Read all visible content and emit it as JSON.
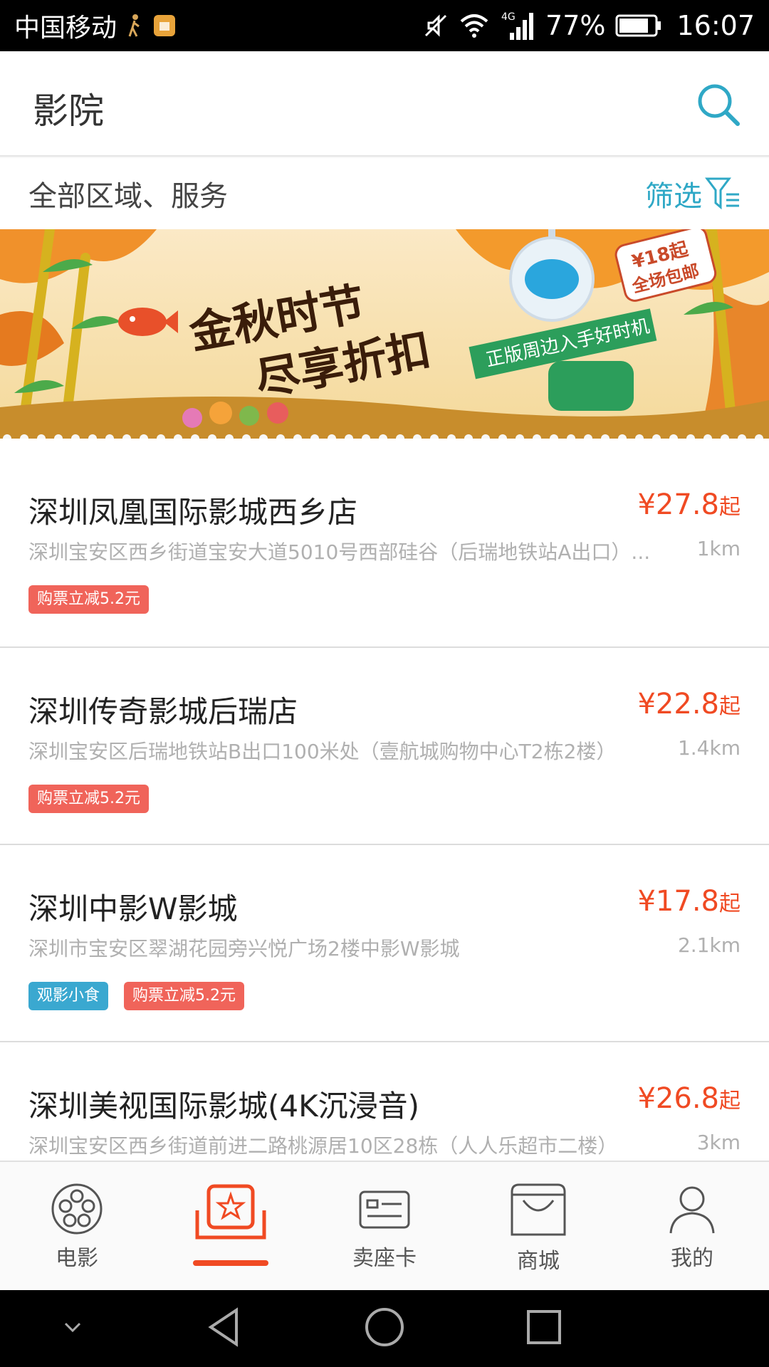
{
  "status_bar": {
    "carrier": "中国移动",
    "network": "4G",
    "battery": "77%",
    "time": "16:07"
  },
  "header": {
    "title": "影院",
    "search_icon": "search-icon"
  },
  "filter_bar": {
    "region": "全部区域、服务",
    "filter_label": "筛选"
  },
  "banner": {
    "headline_line1": "金秋时节",
    "headline_line2": "尽享折扣",
    "ribbon": "正版周边入手好时机",
    "badge_line1": "¥18起",
    "badge_line2": "全场包邮"
  },
  "cinemas": [
    {
      "name": "深圳凤凰国际影城西乡店",
      "price": "¥27.8",
      "price_suffix": "起",
      "address": "深圳宝安区西乡街道宝安大道5010号西部硅谷（后瑞地铁站A出口）...",
      "distance": "1km",
      "tags": [
        "购票立减5.2元"
      ]
    },
    {
      "name": "深圳传奇影城后瑞店",
      "price": "¥22.8",
      "price_suffix": "起",
      "address": "深圳宝安区后瑞地铁站B出口100米处（壹航城购物中心T2栋2楼）",
      "distance": "1.4km",
      "tags": [
        "购票立减5.2元"
      ]
    },
    {
      "name": "深圳中影W影城",
      "price": "¥17.8",
      "price_suffix": "起",
      "address": "深圳市宝安区翠湖花园旁兴悦广场2楼中影W影城",
      "distance": "2.1km",
      "tags": [
        "观影小食",
        "购票立减5.2元"
      ]
    },
    {
      "name": "深圳美视国际影城(4K沉浸音)",
      "price": "¥26.8",
      "price_suffix": "起",
      "address": "深圳宝安区西乡街道前进二路桃源居10区28栋（人人乐超市二楼）",
      "distance": "3km",
      "tags": []
    }
  ],
  "bottom_nav": [
    {
      "label": "电影",
      "icon": "film-reel-icon",
      "active": false
    },
    {
      "label": "",
      "icon": "cinema-seat-icon",
      "active": true
    },
    {
      "label": "卖座卡",
      "icon": "card-icon",
      "active": false
    },
    {
      "label": "商城",
      "icon": "shopping-bag-icon",
      "active": false
    },
    {
      "label": "我的",
      "icon": "person-icon",
      "active": false
    }
  ],
  "colors": {
    "accent": "#f04a23",
    "teal": "#2fa8c6",
    "tag_red": "#f0645a",
    "tag_blue": "#3aa8d0"
  }
}
